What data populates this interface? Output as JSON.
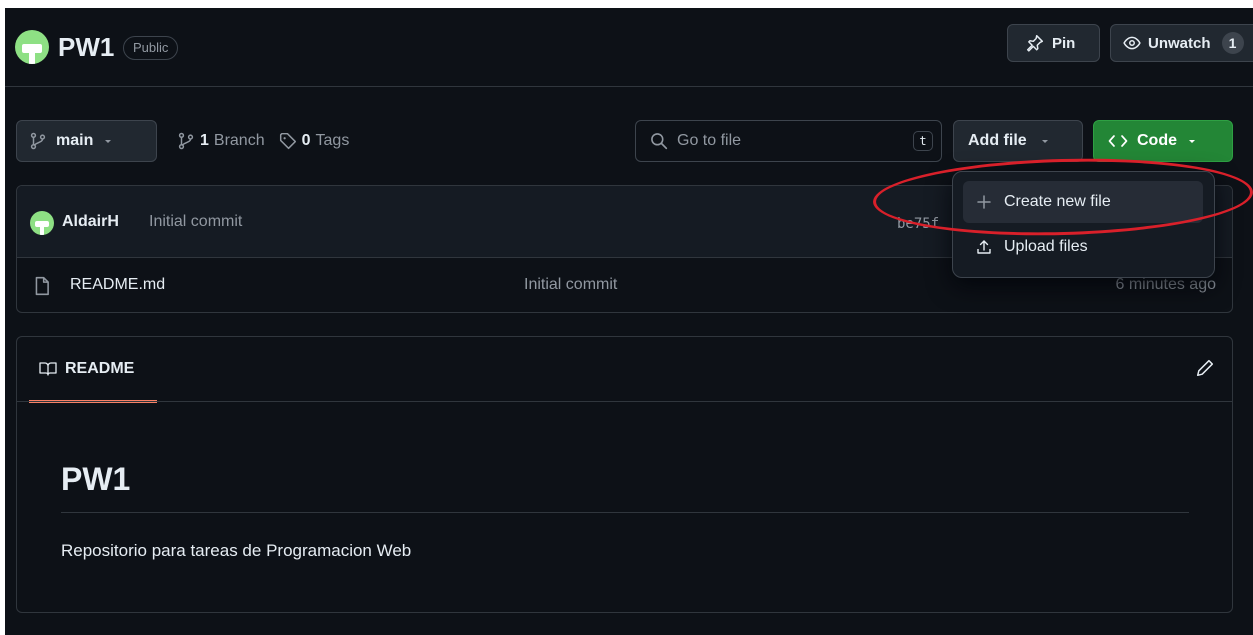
{
  "repo": {
    "name": "PW1",
    "visibility": "Public",
    "pin_label": "Pin",
    "watch_label": "Unwatch",
    "watch_count": "1"
  },
  "toolbar": {
    "branch": "main",
    "branch_count": "1",
    "branch_label": "Branch",
    "tag_count": "0",
    "tag_label": "Tags",
    "search_placeholder": "Go to file",
    "search_shortcut": "t",
    "add_file_label": "Add file",
    "code_label": "Code"
  },
  "dropdown": {
    "items": [
      {
        "label": "Create new file",
        "icon": "plus-icon"
      },
      {
        "label": "Upload files",
        "icon": "upload-icon"
      }
    ]
  },
  "latest_commit": {
    "author": "AldairH",
    "message": "Initial commit",
    "hash": "be75f"
  },
  "files": [
    {
      "name": "README.md",
      "commit": "Initial commit",
      "time": "6 minutes ago",
      "icon": "file-icon"
    }
  ],
  "readme": {
    "tab_label": "README",
    "title": "PW1",
    "body": "Repositorio para tareas de Programacion Web"
  },
  "colors": {
    "background": "#0d1117",
    "code_button": "#238636",
    "active_tab_underline": "#f78166",
    "annotation": "#d9202a"
  }
}
